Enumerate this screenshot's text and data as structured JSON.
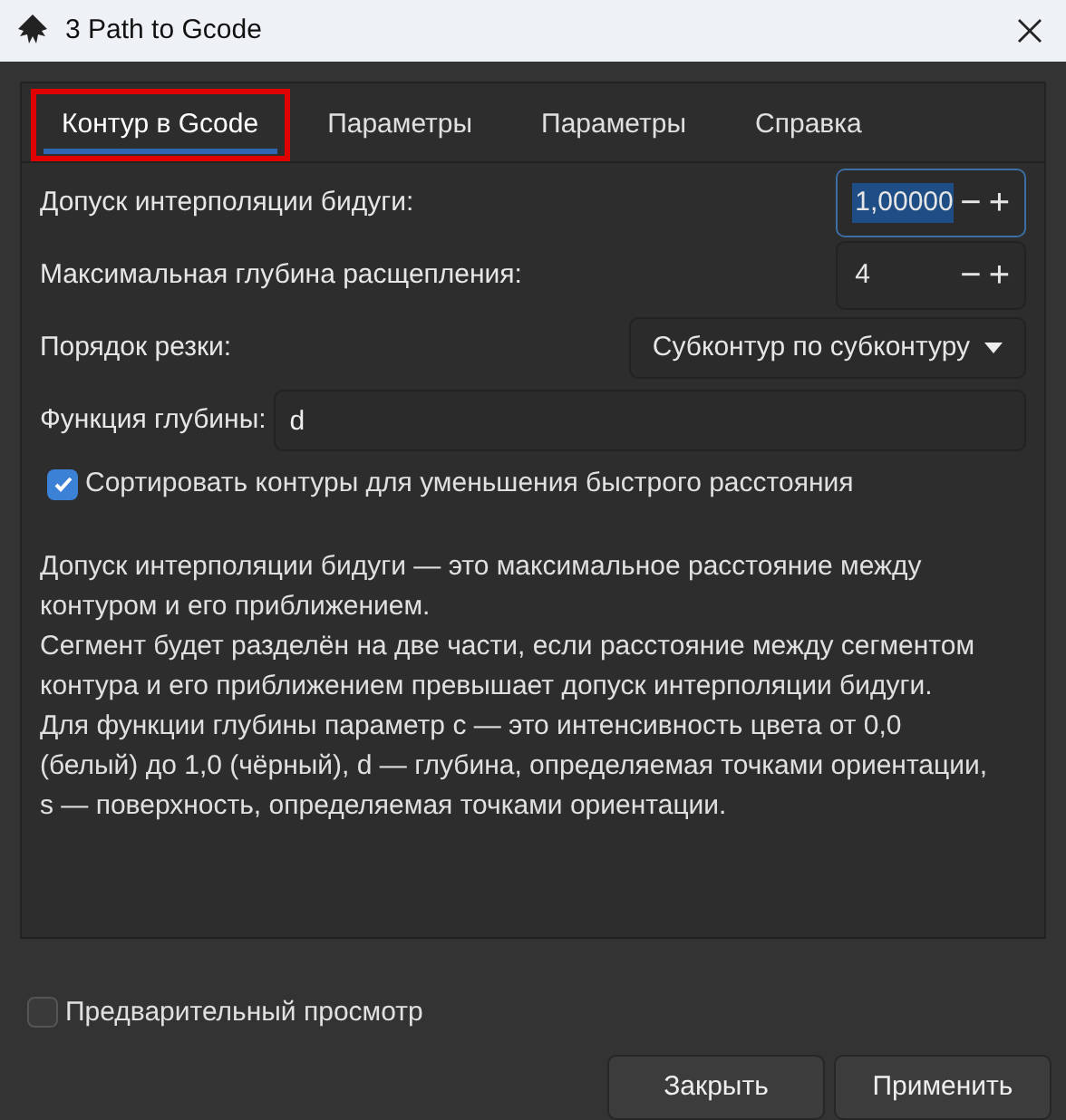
{
  "window": {
    "title": "3 Path to Gcode"
  },
  "tabs": [
    {
      "label": "Контур в Gcode",
      "selected": true,
      "highlighted": true
    },
    {
      "label": "Параметры",
      "selected": false,
      "highlighted": false
    },
    {
      "label": "Параметры",
      "selected": false,
      "highlighted": false
    },
    {
      "label": "Справка",
      "selected": false,
      "highlighted": false
    }
  ],
  "fields": [
    {
      "kind": "spin",
      "label": "Допуск интерполяции бидуги:",
      "value": "1,00000",
      "focused": true,
      "minus": "−",
      "plus": "+"
    },
    {
      "kind": "spin",
      "label": "Максимальная глубина расщепления:",
      "value": "4",
      "focused": false,
      "minus": "−",
      "plus": "+"
    },
    {
      "kind": "dropdown",
      "label": "Порядок резки:",
      "value": "Субконтур по субконтуру"
    },
    {
      "kind": "text",
      "label": "Функция глубины:",
      "value": "d"
    },
    {
      "kind": "checkbox",
      "label": "Сортировать контуры для уменьшения быстрого расстояния",
      "checked": true
    }
  ],
  "description": [
    "Допуск интерполяции бидуги — это максимальное расстояние между контуром и его приближением.",
    "Сегмент будет разделён на две части, если расстояние между сегментом контура и его приближением превышает допуск интерполяции бидуги.",
    "Для функции глубины параметр c — это интенсивность цвета от 0,0 (белый) до 1,0 (чёрный), d — глубина, определяемая точками ориентации, s — поверхность, определяемая точками ориентации."
  ],
  "preview": {
    "label": "Предварительный просмотр",
    "checked": false
  },
  "buttons": [
    "Закрыть",
    "Применить"
  ]
}
